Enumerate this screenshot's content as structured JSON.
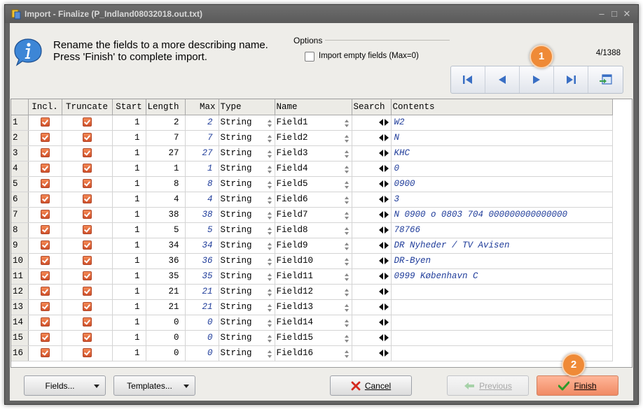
{
  "window": {
    "title": "Import - Finalize  (P_Indland08032018.out.txt)"
  },
  "header": {
    "line1": "Rename the fields to a more describing name.",
    "line2": "Press 'Finish' to complete import."
  },
  "options": {
    "legend": "Options",
    "import_empty_label": "Import empty fields (Max=0)",
    "import_empty_checked": false
  },
  "counter": "4/1388",
  "badges": {
    "nav": "1",
    "finish": "2"
  },
  "nav_buttons": [
    "first-record-icon",
    "previous-record-icon",
    "next-record-icon",
    "last-record-icon",
    "goto-record-icon"
  ],
  "grid": {
    "columns": [
      "",
      "Incl.",
      "Truncate",
      "Start",
      "Length",
      "Max",
      "Type",
      "Name",
      "Search",
      "Contents"
    ],
    "rows": [
      {
        "n": "1",
        "incl": true,
        "trunc": true,
        "start": "1",
        "length": "2",
        "max": "2",
        "type": "String",
        "name": "Field1",
        "contents": "W2"
      },
      {
        "n": "2",
        "incl": true,
        "trunc": true,
        "start": "1",
        "length": "7",
        "max": "7",
        "type": "String",
        "name": "Field2",
        "contents": "N"
      },
      {
        "n": "3",
        "incl": true,
        "trunc": true,
        "start": "1",
        "length": "27",
        "max": "27",
        "type": "String",
        "name": "Field3",
        "contents": "KHC"
      },
      {
        "n": "4",
        "incl": true,
        "trunc": true,
        "start": "1",
        "length": "1",
        "max": "1",
        "type": "String",
        "name": "Field4",
        "contents": "0"
      },
      {
        "n": "5",
        "incl": true,
        "trunc": true,
        "start": "1",
        "length": "8",
        "max": "8",
        "type": "String",
        "name": "Field5",
        "contents": "0900"
      },
      {
        "n": "6",
        "incl": true,
        "trunc": true,
        "start": "1",
        "length": "4",
        "max": "4",
        "type": "String",
        "name": "Field6",
        "contents": "3"
      },
      {
        "n": "7",
        "incl": true,
        "trunc": true,
        "start": "1",
        "length": "38",
        "max": "38",
        "type": "String",
        "name": "Field7",
        "contents": "N  0900  o  0803  704  000000000000000"
      },
      {
        "n": "8",
        "incl": true,
        "trunc": true,
        "start": "1",
        "length": "5",
        "max": "5",
        "type": "String",
        "name": "Field8",
        "contents": "78766"
      },
      {
        "n": "9",
        "incl": true,
        "trunc": true,
        "start": "1",
        "length": "34",
        "max": "34",
        "type": "String",
        "name": "Field9",
        "contents": "DR Nyheder / TV Avisen"
      },
      {
        "n": "10",
        "incl": true,
        "trunc": true,
        "start": "1",
        "length": "36",
        "max": "36",
        "type": "String",
        "name": "Field10",
        "contents": "DR-Byen"
      },
      {
        "n": "11",
        "incl": true,
        "trunc": true,
        "start": "1",
        "length": "35",
        "max": "35",
        "type": "String",
        "name": "Field11",
        "contents": "0999  København C"
      },
      {
        "n": "12",
        "incl": true,
        "trunc": true,
        "start": "1",
        "length": "21",
        "max": "21",
        "type": "String",
        "name": "Field12",
        "contents": ""
      },
      {
        "n": "13",
        "incl": true,
        "trunc": true,
        "start": "1",
        "length": "21",
        "max": "21",
        "type": "String",
        "name": "Field13",
        "contents": ""
      },
      {
        "n": "14",
        "incl": true,
        "trunc": true,
        "start": "1",
        "length": "0",
        "max": "0",
        "type": "String",
        "name": "Field14",
        "contents": ""
      },
      {
        "n": "15",
        "incl": true,
        "trunc": true,
        "start": "1",
        "length": "0",
        "max": "0",
        "type": "String",
        "name": "Field15",
        "contents": ""
      },
      {
        "n": "16",
        "incl": true,
        "trunc": true,
        "start": "1",
        "length": "0",
        "max": "0",
        "type": "String",
        "name": "Field16",
        "contents": ""
      }
    ]
  },
  "footer": {
    "fields_label": "Fields...",
    "templates_label": "Templates...",
    "cancel_label": "Cancel",
    "previous_label": "Previous",
    "finish_label": "Finish"
  },
  "colors": {
    "accent_orange": "#ef8a37",
    "finish_button": "#f08a64",
    "contents_text": "#1f3c9a"
  }
}
